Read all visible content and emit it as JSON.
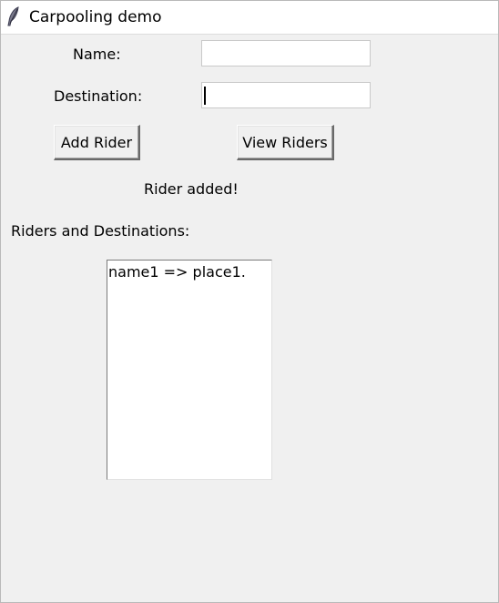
{
  "window": {
    "title": "Carpooling demo",
    "icon": "feather-icon"
  },
  "form": {
    "name_label": "Name:",
    "name_value": "",
    "destination_label": "Destination:",
    "destination_value": ""
  },
  "buttons": {
    "add_rider": "Add Rider",
    "view_riders": "View Riders"
  },
  "status": {
    "message": "Rider added!"
  },
  "riders": {
    "heading": "Riders and Destinations:",
    "items": [
      "name1 => place1."
    ]
  }
}
